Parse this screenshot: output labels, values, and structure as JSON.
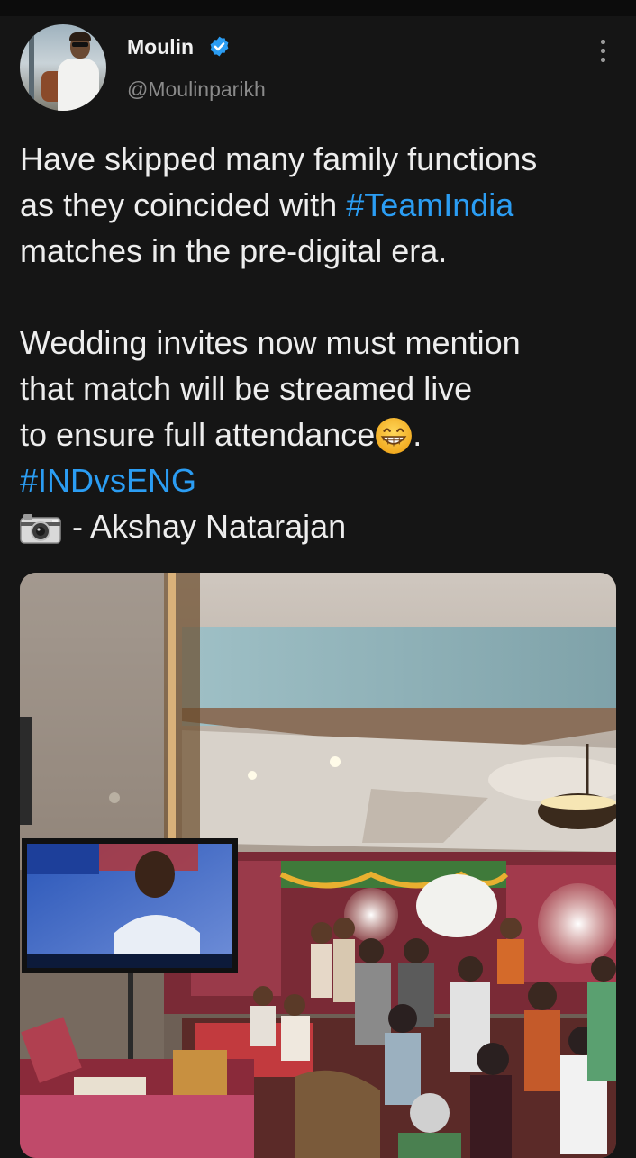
{
  "tweet": {
    "author_name": "Moulin",
    "author_handle": "@Moulinparikh",
    "verified": true,
    "text_lines": {
      "l1": "Have skipped many family functions",
      "l2_pre": "as they coincided with ",
      "l2_tag": "#TeamIndia",
      "l3": "matches in the pre-digital era.",
      "l4": "Wedding invites now must mention",
      "l5": "that match will be streamed live",
      "l6_pre": "to ensure full attendance",
      "l6_post": ".",
      "l7_tag": "#INDvsENG",
      "l8": "- Akshay Natarajan"
    },
    "emoji": "grinning-face-with-smiling-eyes",
    "credit_icon": "camera-icon"
  },
  "colors": {
    "background": "#151515",
    "hashtag": "#2b9df3",
    "verified_badge": "#2b9df3",
    "handle": "#8a8a8a"
  }
}
